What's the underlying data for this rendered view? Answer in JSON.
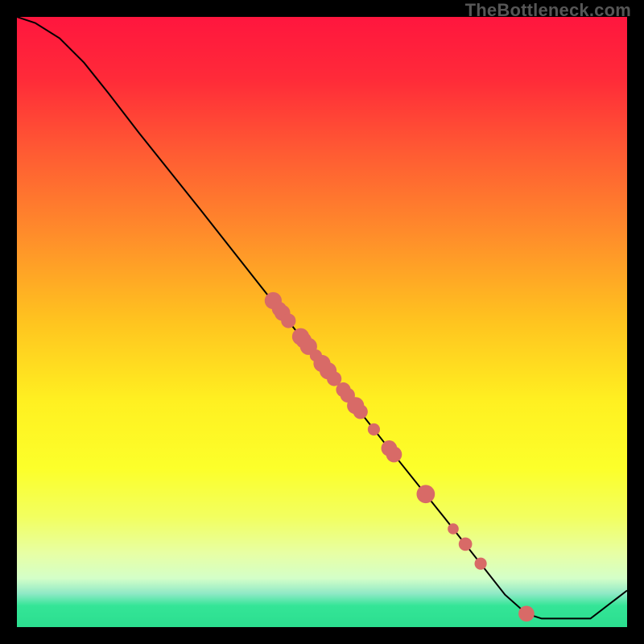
{
  "watermark": "TheBottleneck.com",
  "chart_data": {
    "type": "line",
    "title": "",
    "xlabel": "",
    "ylabel": "",
    "xlim": [
      0,
      100
    ],
    "ylim": [
      0,
      100
    ],
    "gradient_stops": [
      {
        "offset": 0.0,
        "color": "#ff163e"
      },
      {
        "offset": 0.1,
        "color": "#ff2a39"
      },
      {
        "offset": 0.22,
        "color": "#ff5a33"
      },
      {
        "offset": 0.35,
        "color": "#ff8a2b"
      },
      {
        "offset": 0.5,
        "color": "#ffc41f"
      },
      {
        "offset": 0.63,
        "color": "#fff021"
      },
      {
        "offset": 0.74,
        "color": "#fcff2a"
      },
      {
        "offset": 0.82,
        "color": "#f2ff60"
      },
      {
        "offset": 0.88,
        "color": "#e7ffa5"
      },
      {
        "offset": 0.92,
        "color": "#d4ffc8"
      },
      {
        "offset": 0.945,
        "color": "#8fe9c6"
      },
      {
        "offset": 0.965,
        "color": "#34e597"
      },
      {
        "offset": 1.0,
        "color": "#2bde8f"
      }
    ],
    "curve": [
      {
        "x": 0.0,
        "y": 100.0
      },
      {
        "x": 3.0,
        "y": 99.0
      },
      {
        "x": 7.0,
        "y": 96.5
      },
      {
        "x": 11.0,
        "y": 92.5
      },
      {
        "x": 15.0,
        "y": 87.5
      },
      {
        "x": 20.0,
        "y": 81.0
      },
      {
        "x": 30.0,
        "y": 68.5
      },
      {
        "x": 40.0,
        "y": 55.8
      },
      {
        "x": 50.0,
        "y": 43.2
      },
      {
        "x": 60.0,
        "y": 30.5
      },
      {
        "x": 70.0,
        "y": 18.0
      },
      {
        "x": 80.0,
        "y": 5.3
      },
      {
        "x": 83.5,
        "y": 2.2
      },
      {
        "x": 86.0,
        "y": 1.4
      },
      {
        "x": 94.0,
        "y": 1.4
      },
      {
        "x": 100.0,
        "y": 6.0
      }
    ],
    "scatter": [
      {
        "x": 42.0,
        "y": 53.5,
        "r": 1.4
      },
      {
        "x": 43.0,
        "y": 52.1,
        "r": 1.2
      },
      {
        "x": 43.5,
        "y": 51.5,
        "r": 1.3
      },
      {
        "x": 44.5,
        "y": 50.2,
        "r": 1.2
      },
      {
        "x": 46.5,
        "y": 47.6,
        "r": 1.4
      },
      {
        "x": 47.0,
        "y": 47.0,
        "r": 1.3
      },
      {
        "x": 47.8,
        "y": 46.0,
        "r": 1.4
      },
      {
        "x": 49.0,
        "y": 44.5,
        "r": 1.0
      },
      {
        "x": 50.0,
        "y": 43.2,
        "r": 1.4
      },
      {
        "x": 51.0,
        "y": 42.0,
        "r": 1.4
      },
      {
        "x": 52.0,
        "y": 40.7,
        "r": 1.2
      },
      {
        "x": 53.5,
        "y": 38.9,
        "r": 1.2
      },
      {
        "x": 54.2,
        "y": 38.0,
        "r": 1.2
      },
      {
        "x": 55.5,
        "y": 36.3,
        "r": 1.4
      },
      {
        "x": 56.3,
        "y": 35.3,
        "r": 1.2
      },
      {
        "x": 58.5,
        "y": 32.4,
        "r": 1.0
      },
      {
        "x": 61.0,
        "y": 29.3,
        "r": 1.3
      },
      {
        "x": 61.8,
        "y": 28.3,
        "r": 1.3
      },
      {
        "x": 67.0,
        "y": 21.8,
        "r": 1.5
      },
      {
        "x": 71.5,
        "y": 16.1,
        "r": 0.9
      },
      {
        "x": 73.5,
        "y": 13.6,
        "r": 1.1
      },
      {
        "x": 76.0,
        "y": 10.4,
        "r": 1.0
      },
      {
        "x": 83.5,
        "y": 2.2,
        "r": 1.3
      }
    ],
    "colors": {
      "curve": "#000000",
      "scatter": "#d86a67"
    }
  }
}
